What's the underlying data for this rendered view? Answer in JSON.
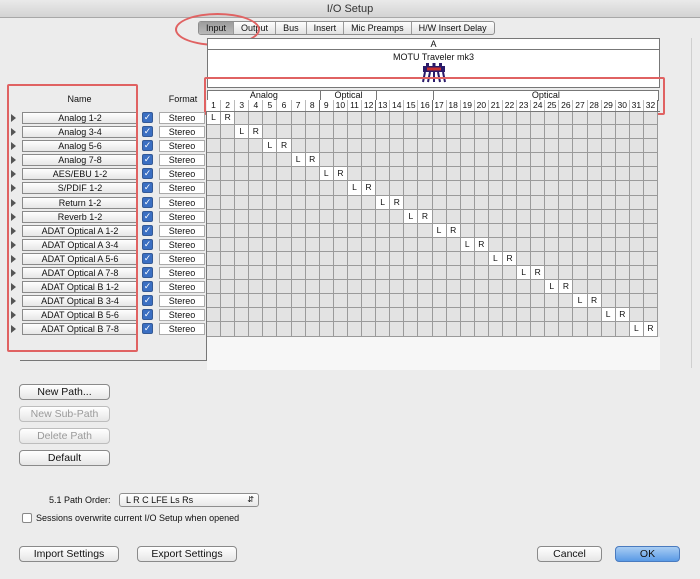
{
  "window": {
    "title": "I/O Setup"
  },
  "tabs": [
    "Input",
    "Output",
    "Bus",
    "Insert",
    "Mic Preamps",
    "H/W Insert Delay"
  ],
  "active_tab": 0,
  "device": {
    "letter": "A",
    "name": "MOTU Traveler mk3",
    "icon": "motu-device-icon",
    "groups": [
      {
        "label": "Analog",
        "start": 1,
        "end": 8
      },
      {
        "label": "Optical",
        "start": 9,
        "end": 12
      },
      {
        "label": "",
        "start": 13,
        "end": 16
      },
      {
        "label": "Optical",
        "start": 17,
        "end": 32
      }
    ],
    "channels": [
      "1",
      "2",
      "3",
      "4",
      "5",
      "6",
      "7",
      "8",
      "9",
      "10",
      "11",
      "12",
      "13",
      "14",
      "15",
      "16",
      "17",
      "18",
      "19",
      "20",
      "21",
      "22",
      "23",
      "24",
      "25",
      "26",
      "27",
      "28",
      "29",
      "30",
      "31",
      "32"
    ]
  },
  "columns": {
    "name": "Name",
    "format": "Format"
  },
  "paths": [
    {
      "name": "Analog 1-2",
      "format": "Stereo",
      "checked": true
    },
    {
      "name": "Analog 3-4",
      "format": "Stereo",
      "checked": true
    },
    {
      "name": "Analog 5-6",
      "format": "Stereo",
      "checked": true
    },
    {
      "name": "Analog 7-8",
      "format": "Stereo",
      "checked": true
    },
    {
      "name": "AES/EBU 1-2",
      "format": "Stereo",
      "checked": true
    },
    {
      "name": "S/PDIF 1-2",
      "format": "Stereo",
      "checked": true
    },
    {
      "name": "Return 1-2",
      "format": "Stereo",
      "checked": true
    },
    {
      "name": "Reverb 1-2",
      "format": "Stereo",
      "checked": true
    },
    {
      "name": "ADAT Optical A 1-2",
      "format": "Stereo",
      "checked": true
    },
    {
      "name": "ADAT Optical A 3-4",
      "format": "Stereo",
      "checked": true
    },
    {
      "name": "ADAT Optical A 5-6",
      "format": "Stereo",
      "checked": true
    },
    {
      "name": "ADAT Optical A 7-8",
      "format": "Stereo",
      "checked": true
    },
    {
      "name": "ADAT Optical B 1-2",
      "format": "Stereo",
      "checked": true
    },
    {
      "name": "ADAT Optical B 3-4",
      "format": "Stereo",
      "checked": true
    },
    {
      "name": "ADAT Optical B 5-6",
      "format": "Stereo",
      "checked": true
    },
    {
      "name": "ADAT Optical B 7-8",
      "format": "Stereo",
      "checked": true
    }
  ],
  "assign_labels": [
    "L",
    "R"
  ],
  "buttons": {
    "new_path": "New Path...",
    "new_sub_path": "New Sub-Path",
    "delete_path": "Delete Path",
    "default": "Default",
    "import": "Import Settings",
    "export": "Export Settings",
    "cancel": "Cancel",
    "ok": "OK"
  },
  "path_order": {
    "label": "5.1 Path Order:",
    "value": "L R C LFE Ls Rs"
  },
  "sessions_overwrite": {
    "label": "Sessions overwrite current I/O Setup when opened",
    "checked": false
  },
  "colors": {
    "highlight": "#e06262",
    "checkbox": "#3b6fc2",
    "ok_button": "#5a9ae6"
  }
}
